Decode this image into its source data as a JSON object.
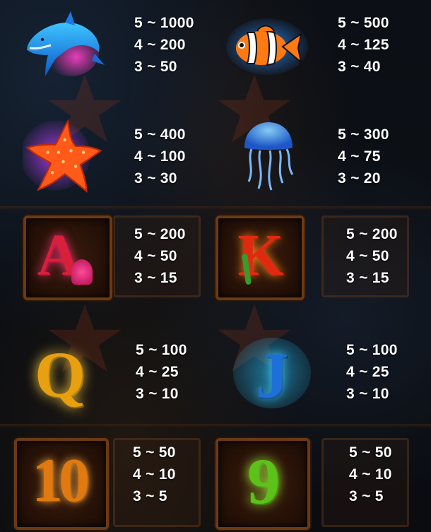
{
  "paytable": [
    {
      "id": "dolphin",
      "symbol_icon": "dolphin-icon",
      "lines": [
        "5 ~ 1000",
        "4 ~ 200",
        "3 ~ 50"
      ]
    },
    {
      "id": "clownfish",
      "symbol_icon": "clownfish-icon",
      "lines": [
        "5 ~ 500",
        "4 ~ 125",
        "3 ~ 40"
      ]
    },
    {
      "id": "starfish",
      "symbol_icon": "starfish-icon",
      "lines": [
        "5 ~ 400",
        "4 ~ 100",
        "3 ~ 30"
      ]
    },
    {
      "id": "jellyfish",
      "symbol_icon": "jellyfish-icon",
      "lines": [
        "5 ~ 300",
        "4 ~ 75",
        "3 ~ 20"
      ]
    },
    {
      "id": "a",
      "symbol_icon": "letter-a-icon",
      "letter": "A",
      "lines": [
        "5 ~ 200",
        "4 ~ 50",
        "3 ~ 15"
      ]
    },
    {
      "id": "k",
      "symbol_icon": "letter-k-icon",
      "letter": "K",
      "lines": [
        "5 ~ 200",
        "4 ~ 50",
        "3 ~ 15"
      ]
    },
    {
      "id": "q",
      "symbol_icon": "letter-q-icon",
      "letter": "Q",
      "lines": [
        "5 ~ 100",
        "4 ~ 25",
        "3 ~ 10"
      ]
    },
    {
      "id": "j",
      "symbol_icon": "letter-j-icon",
      "letter": "J",
      "lines": [
        "5 ~ 100",
        "4 ~ 25",
        "3 ~ 10"
      ]
    },
    {
      "id": "ten",
      "symbol_icon": "number-10-icon",
      "letter": "10",
      "lines": [
        "5 ~ 50",
        "4 ~ 10",
        "3 ~ 5"
      ]
    },
    {
      "id": "nine",
      "symbol_icon": "number-9-icon",
      "letter": "9",
      "lines": [
        "5 ~ 50",
        "4 ~ 10",
        "3 ~ 5"
      ]
    }
  ],
  "colors": {
    "pay_text": "#ffffff",
    "background": "#0a0d12",
    "letter_a": "#d8203a",
    "letter_k": "#e02a10",
    "letter_q": "#e8a010",
    "letter_j": "#1e6fd8",
    "number_10": "#e07a10",
    "number_9": "#5cc21a"
  }
}
